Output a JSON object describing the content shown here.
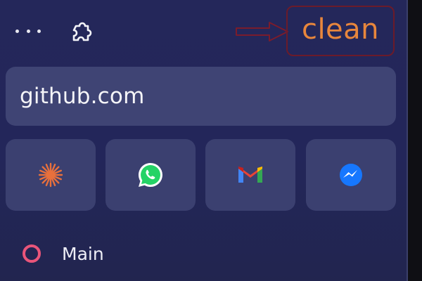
{
  "toolbar": {
    "menu_icon": "more-horizontal-icon",
    "extensions_icon": "puzzle-piece-icon"
  },
  "annotation": {
    "text": "clean",
    "text_color": "#e8863c",
    "border_color": "#6b1b2a"
  },
  "address_bar": {
    "value": "github.com"
  },
  "quick_links": [
    {
      "icon": "sunburst-icon",
      "color": "#e8703c"
    },
    {
      "icon": "whatsapp-icon",
      "color": "#25d366"
    },
    {
      "icon": "gmail-icon",
      "color": "#ea4335"
    },
    {
      "icon": "messenger-icon",
      "color": "#1677ff"
    }
  ],
  "workspace": {
    "label": "Main",
    "indicator_color": "#e9557a"
  },
  "colors": {
    "background": "#24275a",
    "surface": "#3f4474"
  }
}
